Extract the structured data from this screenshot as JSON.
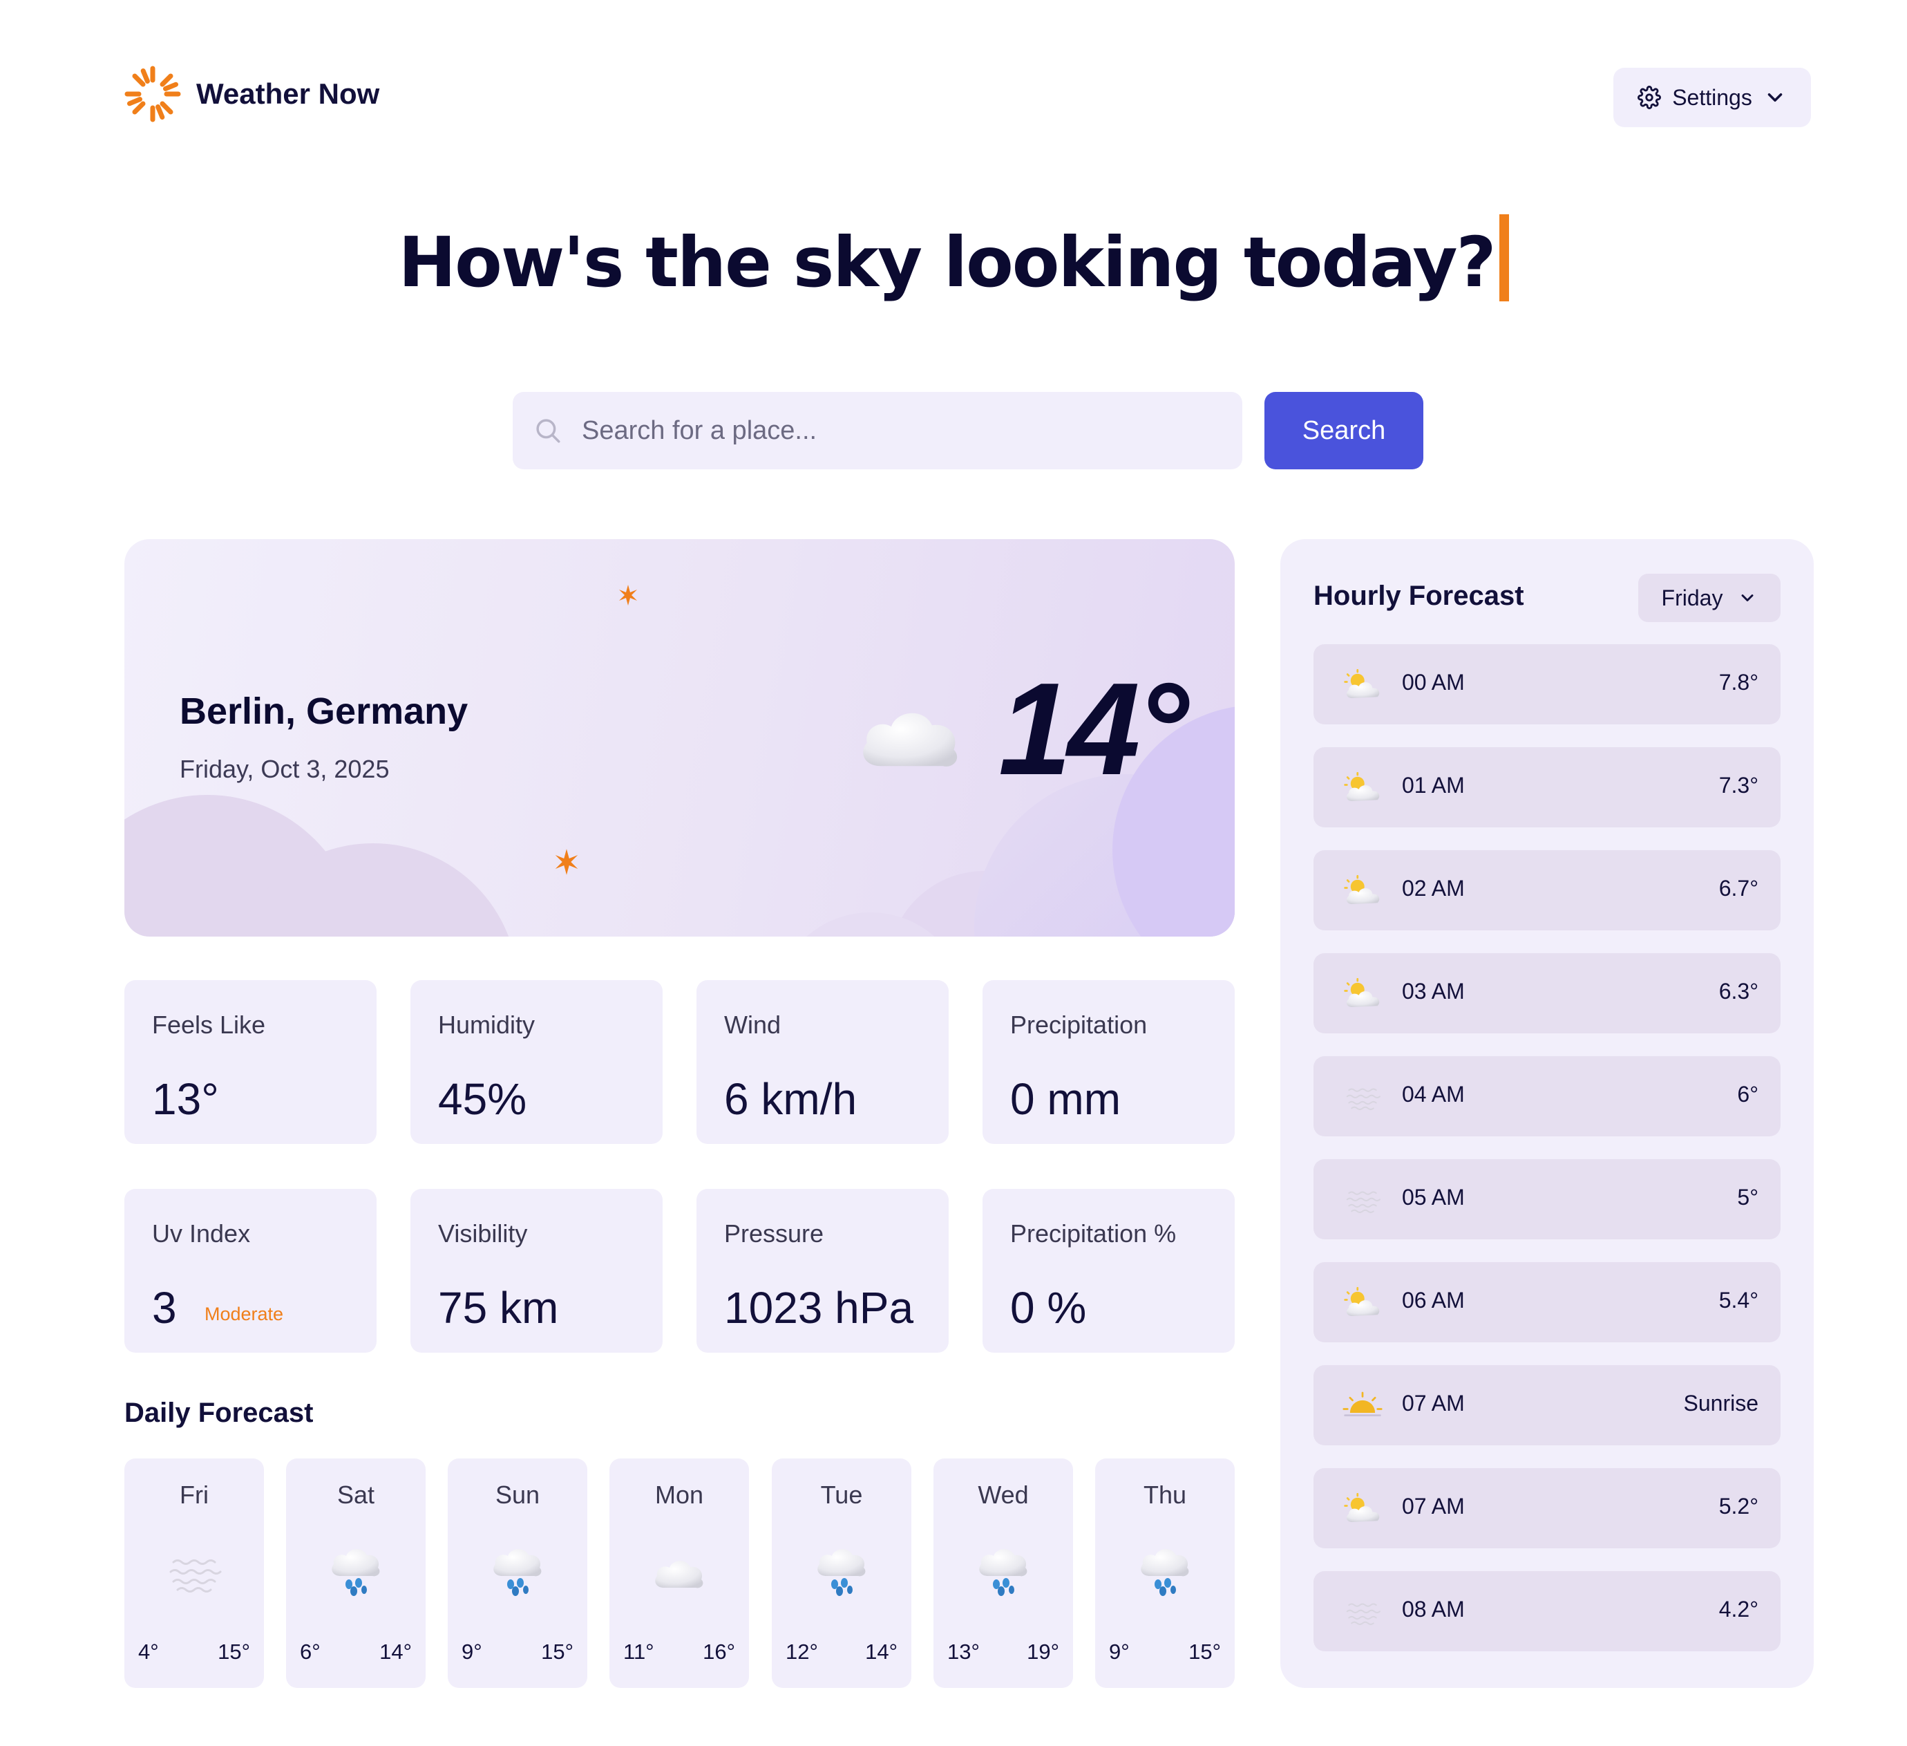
{
  "app": {
    "name": "Weather Now"
  },
  "header": {
    "settings_label": "Settings"
  },
  "hero": {
    "title": "How's the sky looking today?"
  },
  "search": {
    "placeholder": "Search for a place...",
    "button_label": "Search"
  },
  "current": {
    "city": "Berlin, Germany",
    "date": "Friday, Oct 3, 2025",
    "temperature": "14°",
    "icon": "cloud-icon"
  },
  "metrics": [
    {
      "label": "Feels Like",
      "value": "13°"
    },
    {
      "label": "Humidity",
      "value": "45%"
    },
    {
      "label": "Wind",
      "value": "6 km/h"
    },
    {
      "label": "Precipitation",
      "value": "0 mm"
    },
    {
      "label": "Uv Index",
      "value": "3",
      "sub": "Moderate"
    },
    {
      "label": "Visibility",
      "value": "75 km"
    },
    {
      "label": "Pressure",
      "value": "1023 hPa"
    },
    {
      "label": "Precipitation %",
      "value": "0 %"
    }
  ],
  "daily": {
    "title": "Daily Forecast",
    "days": [
      {
        "name": "Fri",
        "low": "4°",
        "high": "15°",
        "icon": "fog-icon"
      },
      {
        "name": "Sat",
        "low": "6°",
        "high": "14°",
        "icon": "rain-icon"
      },
      {
        "name": "Sun",
        "low": "9°",
        "high": "15°",
        "icon": "rain-icon"
      },
      {
        "name": "Mon",
        "low": "11°",
        "high": "16°",
        "icon": "cloud-icon"
      },
      {
        "name": "Tue",
        "low": "12°",
        "high": "14°",
        "icon": "rain-icon"
      },
      {
        "name": "Wed",
        "low": "13°",
        "high": "19°",
        "icon": "rain-icon"
      },
      {
        "name": "Thu",
        "low": "9°",
        "high": "15°",
        "icon": "rain-icon"
      }
    ]
  },
  "hourly": {
    "title": "Hourly Forecast",
    "selected_day": "Friday",
    "rows": [
      {
        "time": "00 AM",
        "temp": "7.8°",
        "icon": "partly-cloudy-icon"
      },
      {
        "time": "01 AM",
        "temp": "7.3°",
        "icon": "partly-cloudy-icon"
      },
      {
        "time": "02 AM",
        "temp": "6.7°",
        "icon": "partly-cloudy-icon"
      },
      {
        "time": "03 AM",
        "temp": "6.3°",
        "icon": "partly-cloudy-icon"
      },
      {
        "time": "04 AM",
        "temp": "6°",
        "icon": "fog-icon"
      },
      {
        "time": "05 AM",
        "temp": "5°",
        "icon": "fog-icon"
      },
      {
        "time": "06 AM",
        "temp": "5.4°",
        "icon": "partly-cloudy-icon"
      },
      {
        "time": "07 AM",
        "temp": "Sunrise",
        "icon": "sunrise-icon"
      },
      {
        "time": "07 AM",
        "temp": "5.2°",
        "icon": "partly-cloudy-icon"
      },
      {
        "time": "08 AM",
        "temp": "4.2°",
        "icon": "fog-icon"
      }
    ]
  },
  "colors": {
    "accent": "#4a53dc",
    "brand": "#f07f1a",
    "card": "#f1eefb",
    "ink": "#12103a"
  }
}
